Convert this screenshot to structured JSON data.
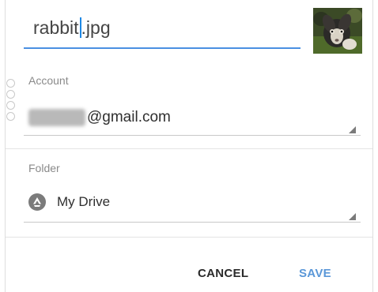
{
  "dialog": {
    "filename": {
      "before_caret": "rabbit",
      "after_caret": ".jpg"
    },
    "thumbnail": {
      "icon": "rabbit-photo-thumbnail"
    },
    "account": {
      "label": "Account",
      "domain": "@gmail.com"
    },
    "folder": {
      "label": "Folder",
      "value": "My Drive",
      "icon": "google-drive-icon"
    },
    "buttons": {
      "cancel": "CANCEL",
      "save": "SAVE"
    },
    "colors": {
      "accent": "#4a90e2",
      "save_text": "#5a97d8"
    }
  }
}
